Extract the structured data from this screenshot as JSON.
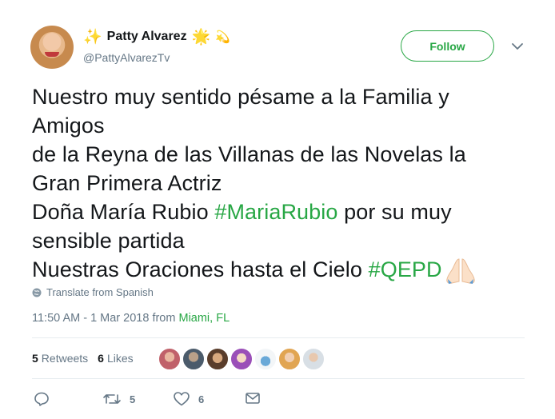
{
  "user": {
    "display_name": "Patty Alvarez",
    "handle": "@PattyAlvarezTv",
    "name_prefix_emoji": "✨",
    "name_suffix_emoji_1": "🌟",
    "name_suffix_emoji_2": "💫"
  },
  "follow": {
    "label": "Follow"
  },
  "tweet": {
    "line1": "Nuestro muy sentido pésame a la Familia y",
    "line2": "Amigos",
    "line3": "de la Reyna de las Villanas de las Novelas la",
    "line4": "Gran Primera Actriz",
    "line5_pre": "Doña María Rubio ",
    "hashtag1": "#MariaRubio",
    "line5_post": " por su muy",
    "line6": "sensible partida",
    "line7_pre": "Nuestras Oraciones hasta el Cielo ",
    "hashtag2": "#QEPD"
  },
  "translate": {
    "label": "Translate from Spanish"
  },
  "meta": {
    "datetime": "11:50 AM - 1 Mar 2018 from ",
    "location": "Miami, FL"
  },
  "stats": {
    "retweets_count": "5",
    "retweets_label": "Retweets",
    "likes_count": "6",
    "likes_label": "Likes"
  },
  "actions": {
    "retweet_count": "5",
    "like_count": "6"
  },
  "colors": {
    "accent": "#28a745",
    "muted": "#657786",
    "text": "#14171a"
  }
}
